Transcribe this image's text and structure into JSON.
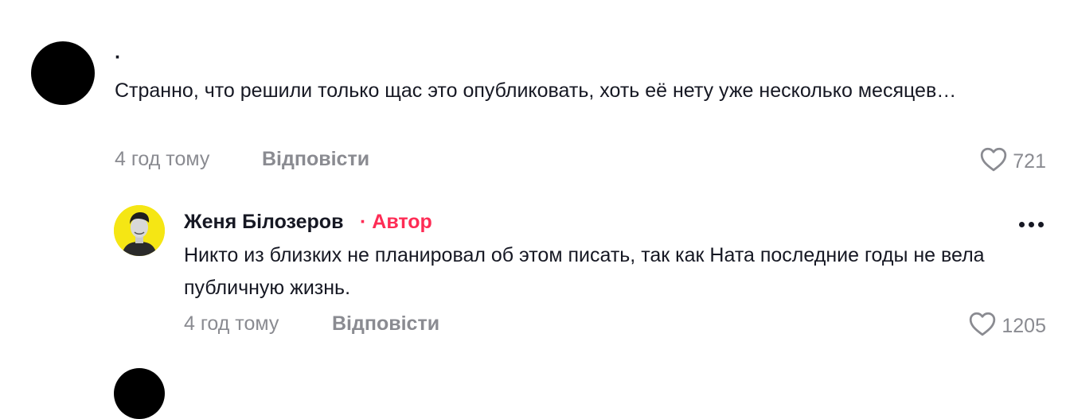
{
  "comments": [
    {
      "username": "·",
      "text": "Странно, что решили только щас это опубликовать, хоть её нету уже несколько месяцев…",
      "time": "4 год тому",
      "reply_label": "Відповісти",
      "likes": "721",
      "like_icon": "heart-outline-icon"
    }
  ],
  "replies": [
    {
      "username": "Женя Білозеров",
      "badge": "· Автор",
      "text": "Никто из близких не планировал об этом писать, так как Ната последние годы не вела публичную жизнь.",
      "time": "4 год тому",
      "reply_label": "Відповісти",
      "likes": "1205",
      "like_icon": "heart-outline-icon",
      "more_icon": "more-dots-icon",
      "avatar_bg": "#f5e614"
    }
  ]
}
